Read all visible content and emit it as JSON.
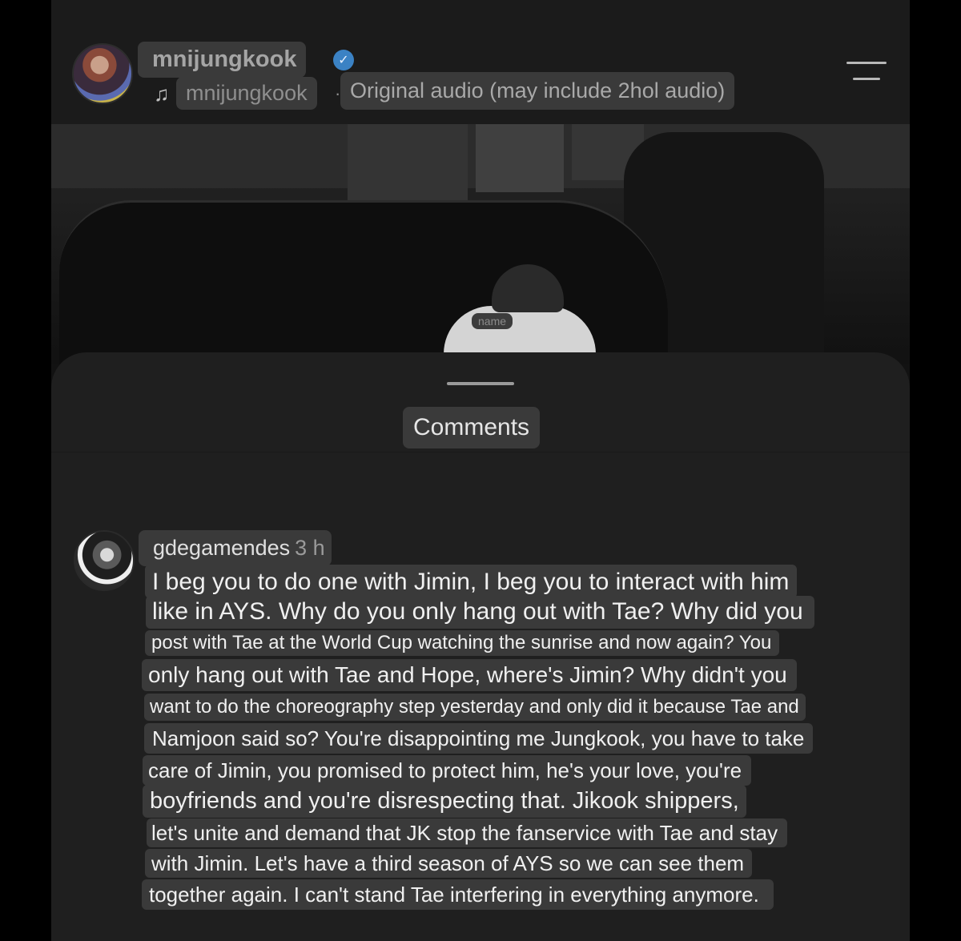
{
  "header": {
    "username": "mnijungkook",
    "verified_icon": "verified-badge-icon",
    "music_icon": "music-note-icon",
    "audio_user": "mnijungkook",
    "audio_separator": "·",
    "audio_title": "Original audio (may include 2hol audio)",
    "menu_icon": "menu-icon"
  },
  "video": {
    "name_tag": "name"
  },
  "comments_sheet": {
    "title": "Comments",
    "comment": {
      "username": "gdegamendes",
      "time": "3 h",
      "lines": [
        "I beg you to do one with Jimin, I beg you to interact with him",
        "like in AYS. Why do you only hang out with Tae? Why did you",
        "post with Tae at the World Cup watching the sunrise and now again? You",
        "only hang out with Tae and Hope, where's Jimin? Why didn't you",
        "want to do the choreography step yesterday and only did it because Tae and",
        "Namjoon said so? You're disappointing me Jungkook, you have to take",
        "care of Jimin, you promised to protect him, he's your love, you're",
        "boyfriends and you're disrespecting that. Jikook shippers,",
        "let's unite and demand that JK stop the fanservice with Tae and stay",
        "with Jimin. Let's have a third season of AYS so we can see them",
        "together again. I can't stand Tae interfering in everything anymore."
      ]
    }
  },
  "colors": {
    "background": "#121212",
    "sheet": "#1f1f1f",
    "chip": "#3a3a3a",
    "verified": "#3b82c4"
  }
}
